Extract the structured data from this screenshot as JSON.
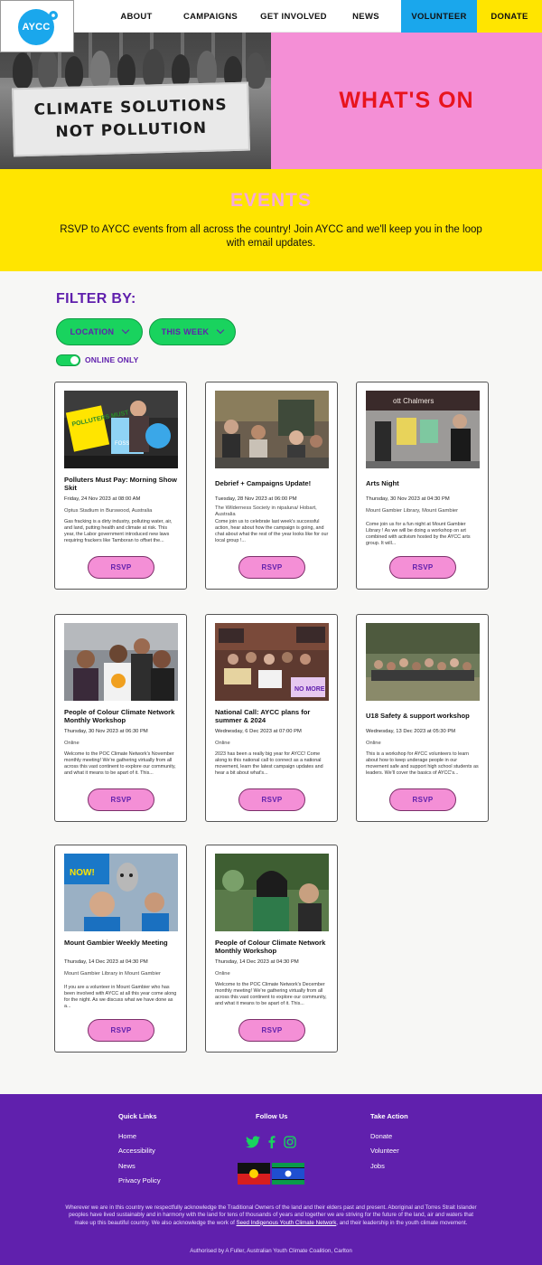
{
  "header": {
    "logo_text": "AYCC",
    "nav": [
      "ABOUT",
      "CAMPAIGNS",
      "GET INVOLVED",
      "NEWS",
      "VOLUNTEER",
      "DONATE"
    ]
  },
  "hero": {
    "banner_lines": [
      "CLIMATE SOLUTIONS",
      "NOT POLLUTION"
    ],
    "title": "WHAT'S ON"
  },
  "events": {
    "title": "EVENTS",
    "intro": "RSVP to AYCC events from all across the country! Join AYCC and we'll keep you in the loop with email updates."
  },
  "filters": {
    "label": "FILTER BY:",
    "location": "LOCATION",
    "week": "THIS WEEK",
    "online_only": "ONLINE ONLY",
    "online_only_on": true
  },
  "cards": [
    {
      "title": "Polluters Must Pay: Morning Show Skit",
      "date": "Friday, 24 Nov 2023 at 08:00 AM",
      "location": "Optus Stadium in Burswood, Australia",
      "description": "Gas fracking is a dirty industry, polluting water, air, and land, putting health and climate at risk. This year, the Labor government introduced new laws requiring frackers like Tamboran to offset the...",
      "sign_text_1": "POLLUTERS MUST PAY",
      "sign_text_2": "FOSSIL",
      "button": "RSVP"
    },
    {
      "title": "Debrief + Campaigns Update!",
      "date": "Tuesday, 28 Nov 2023 at 06:00 PM",
      "location": "The Wilderness Society in nipaluna/ Hobart, Australia",
      "description": "Come join us to celebrate last week's successful action, hear about how the campaign is going, and chat about what the rest of the year looks like for our local group !...",
      "button": "RSVP"
    },
    {
      "title": "Arts Night",
      "date": "Thursday, 30 Nov 2023 at 04:30 PM",
      "location": "Mount Gambier Library, Mount Gambier",
      "description": "Come join us for a fun night at Mount Gambier Library ! As we will be doing a workshop on art combined with activism hosted by the AYCC arts group. It will...",
      "sign_text_1": "ott Chalmers",
      "button": "RSVP"
    },
    {
      "title": "People of Colour Climate Network Monthly Workshop",
      "date": "Thursday, 30 Nov 2023 at 06:30 PM",
      "location": "Online",
      "description": "Welcome to the POC Climate Network's November monthly meeting! We're gathering virtually from all across this vast continent to explore our community, and what it means to be apart of it. This...",
      "button": "RSVP"
    },
    {
      "title": "National Call: AYCC plans for summer & 2024",
      "date": "Wednesday, 6 Dec 2023 at 07:00 PM",
      "location": "Online",
      "description": "2023 has been a really big year for AYCC! Come along to this national call to connect as a national movement, learn the latest campaign updates and hear a bit about what's...",
      "sign_text_1": "NO MORE",
      "button": "RSVP"
    },
    {
      "title": "U18 Safety & support workshop",
      "date": "Wednesday, 13 Dec 2023 at 05:30 PM",
      "location": "Online",
      "description": "This is a workshop for AYCC volunteers to learn about how to keep underage people in our movement safe and support high school students as leaders. We'll cover the basics of AYCC's...",
      "button": "RSVP"
    },
    {
      "title": "Mount Gambier Weekly Meeting",
      "date": "Thursday, 14 Dec 2023 at 04:30 PM",
      "location": "Mount Gambier Library in Mount Gambier",
      "description": "If you are a volunteer in Mount Gambier who has been involved with AYCC at all this year come along for the night. As we discuss what we have done as a...",
      "sign_text_1": "NOW!",
      "button": "RSVP"
    },
    {
      "title": "People of Colour Climate Network Monthly Workshop",
      "date": "Thursday, 14 Dec 2023 at 04:30 PM",
      "location": "Online",
      "description": "Welcome to the POC Climate Network's December monthly meeting! We're gathering virtually from all across this vast continent to explore our community, and what it means to be apart of it. This...",
      "button": "RSVP"
    }
  ],
  "footer": {
    "quick_links_title": "Quick Links",
    "quick_links": [
      "Home",
      "Accessibility",
      "News",
      "Privacy Policy"
    ],
    "follow_title": "Follow Us",
    "take_action_title": "Take Action",
    "take_action": [
      "Donate",
      "Volunteer",
      "Jobs"
    ],
    "ack_text": "Wherever we are in this country we respectfully acknowledge the Traditional Owners of the land and their elders past and present. Aboriginal and Torres Strait Islander peoples have lived sustainably and in harmony with the land for tens of thousands of years and together we are striving for the future of the land, air and waters that make up this beautiful country. We also acknowledge the work of",
    "ack_link": "Seed Indigenous Youth Climate Network",
    "ack_tail": ", and their leadership in the youth climate movement.",
    "authorised": "Authorised by A Fuller, Australian Youth Climate Coalition, Carlton"
  },
  "colors": {
    "purple": "#6020ad",
    "pink": "#f48fd6",
    "yellow": "#ffe500",
    "blue": "#1aa7ec",
    "green": "#19d35e",
    "red": "#e8141d"
  }
}
